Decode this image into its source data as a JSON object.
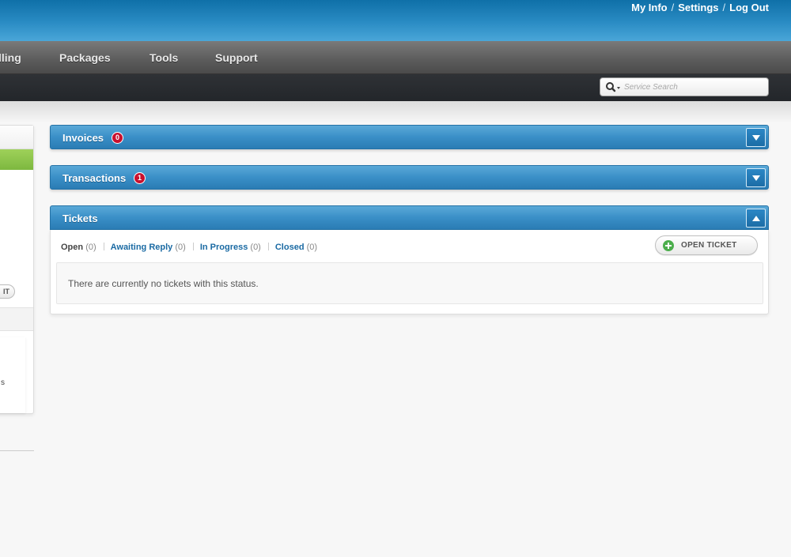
{
  "top_links": {
    "my_info": "My Info",
    "settings": "Settings",
    "log_out": "Log Out",
    "separator": "/"
  },
  "nav": {
    "billing": "lling",
    "packages": "Packages",
    "tools": "Tools",
    "support": "Support"
  },
  "search": {
    "placeholder": "Service Search",
    "icon": "search-icon"
  },
  "sidebar": {
    "button_label": "IT",
    "text_fragment": "s"
  },
  "widgets": {
    "invoices": {
      "title": "Invoices",
      "badge": "0",
      "state": "collapsed"
    },
    "transactions": {
      "title": "Transactions",
      "badge": "1",
      "state": "collapsed"
    },
    "tickets": {
      "title": "Tickets",
      "state": "expanded",
      "tabs": [
        {
          "label": "Open",
          "count": "(0)"
        },
        {
          "label": "Awaiting Reply",
          "count": "(0)"
        },
        {
          "label": "In Progress",
          "count": "(0)"
        },
        {
          "label": "Closed",
          "count": "(0)"
        }
      ],
      "open_button": "OPEN TICKET",
      "empty_message": "There are currently no tickets with this status."
    }
  },
  "colors": {
    "header_blue": "#2a8cc4",
    "nav_gray": "#5b5b5b",
    "badge_red": "#c8102e",
    "sidebar_green": "#8bc34a",
    "link_blue": "#1a6aa3"
  }
}
